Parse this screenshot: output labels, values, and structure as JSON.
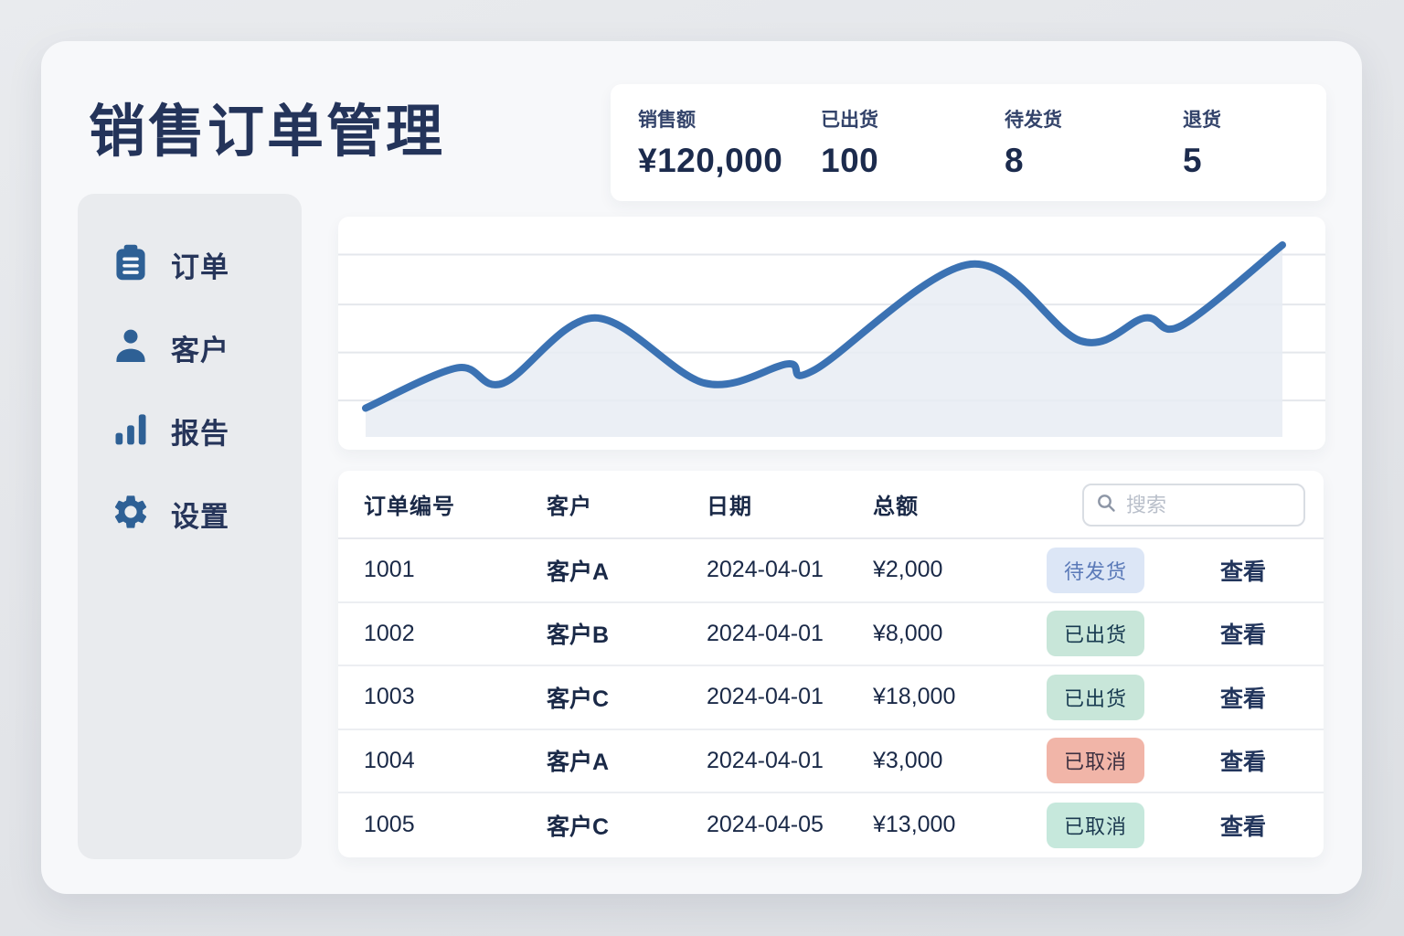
{
  "page": {
    "title": "销售订单管理"
  },
  "stats": [
    {
      "label": "销售额",
      "value": "¥120,000"
    },
    {
      "label": "已出货",
      "value": "100"
    },
    {
      "label": "待发货",
      "value": "8"
    },
    {
      "label": "退货",
      "value": "5"
    }
  ],
  "sidebar": {
    "items": [
      {
        "label": "订单",
        "icon": "clipboard-icon"
      },
      {
        "label": "客户",
        "icon": "user-icon"
      },
      {
        "label": "报告",
        "icon": "bar-chart-icon"
      },
      {
        "label": "设置",
        "icon": "gear-icon"
      }
    ]
  },
  "chart_data": {
    "type": "area",
    "title": "",
    "xlabel": "",
    "ylabel": "",
    "x_percent": [
      0,
      10,
      15,
      25,
      37,
      46,
      49,
      66,
      78,
      85,
      89,
      100
    ],
    "values": [
      15,
      36,
      28,
      62,
      28,
      38,
      35,
      90,
      50,
      62,
      58,
      100
    ],
    "ylim": [
      0,
      100
    ],
    "grid": true,
    "gridline_values": [
      19,
      44,
      69,
      95
    ],
    "legend": "none",
    "line_color": "#3b72b3",
    "fill_color": "#e8ecf3",
    "grid_color": "#e4e7ec"
  },
  "table": {
    "headers": [
      "订单编号",
      "客户",
      "日期",
      "总额"
    ],
    "search_placeholder": "搜索",
    "rows": [
      {
        "id": "1001",
        "customer": "客户A",
        "date": "2024-04-01",
        "amount": "¥2,000",
        "status": "待发货",
        "status_type": "pending",
        "action": "查看"
      },
      {
        "id": "1002",
        "customer": "客户B",
        "date": "2024-04-01",
        "amount": "¥8,000",
        "status": "已出货",
        "status_type": "shipped",
        "action": "查看"
      },
      {
        "id": "1003",
        "customer": "客户C",
        "date": "2024-04-01",
        "amount": "¥18,000",
        "status": "已出货",
        "status_type": "shipped",
        "action": "查看"
      },
      {
        "id": "1004",
        "customer": "客户A",
        "date": "2024-04-01",
        "amount": "¥3,000",
        "status": "已取消",
        "status_type": "cancelled-red",
        "action": "查看"
      },
      {
        "id": "1005",
        "customer": "客户C",
        "date": "2024-04-05",
        "amount": "¥13,000",
        "status": "已取消",
        "status_type": "cancelled-green",
        "action": "查看"
      }
    ]
  },
  "colors": {
    "accent_blue": "#3b72b3",
    "icon_blue": "#2e6095",
    "navy_text": "#24345a",
    "badge_pending_bg": "#dce6f6",
    "badge_shipped_bg": "#c8e6d9",
    "badge_cancelled_red_bg": "#f1b5a8",
    "badge_cancelled_green_bg": "#c6e8dc"
  }
}
